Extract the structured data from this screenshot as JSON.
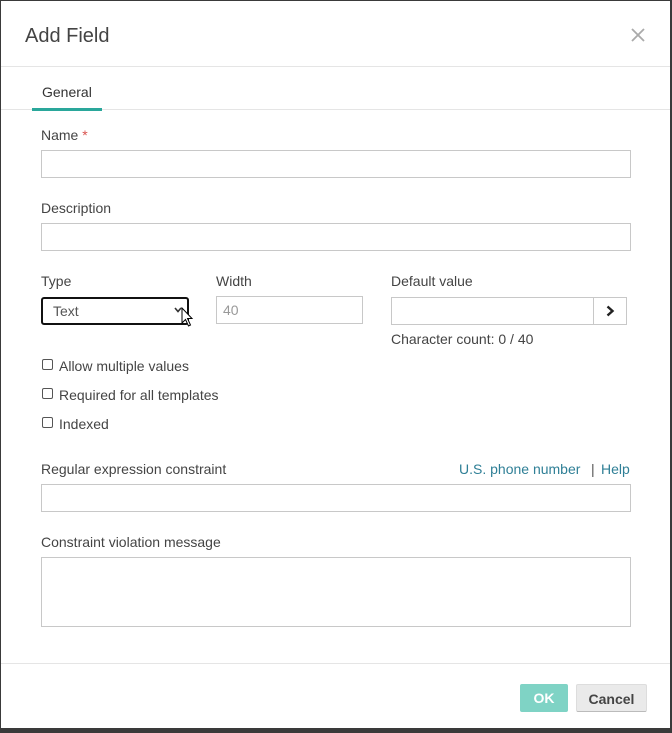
{
  "dialog": {
    "title": "Add Field"
  },
  "tabs": [
    {
      "label": "General",
      "active": true
    }
  ],
  "fields": {
    "name": {
      "label": "Name",
      "required_marker": "*",
      "value": ""
    },
    "description": {
      "label": "Description",
      "value": ""
    },
    "type": {
      "label": "Type",
      "selected": "Text"
    },
    "width": {
      "label": "Width",
      "value": "40"
    },
    "default_value": {
      "label": "Default value",
      "value": "",
      "char_count": "Character count: 0 / 40"
    },
    "regex": {
      "label": "Regular expression constraint",
      "value": ""
    },
    "violation_message": {
      "label": "Constraint violation message",
      "value": ""
    }
  },
  "checkboxes": [
    {
      "label": "Allow multiple values",
      "checked": false
    },
    {
      "label": "Required for all templates",
      "checked": false
    },
    {
      "label": "Indexed",
      "checked": false
    }
  ],
  "links": {
    "phone": "U.S. phone number",
    "separator": "|",
    "help": "Help"
  },
  "buttons": {
    "ok": "OK",
    "cancel": "Cancel"
  },
  "colors": {
    "accent": "#2aa79b",
    "ok_button": "#7fd3c5",
    "link": "#2f7f96",
    "required": "#d9534f"
  },
  "icons": {
    "close": "close-icon",
    "type_dropdown": "chevron-down-icon",
    "default_value_button": "chevron-right-icon",
    "pointer": "mouse-pointer-icon"
  }
}
